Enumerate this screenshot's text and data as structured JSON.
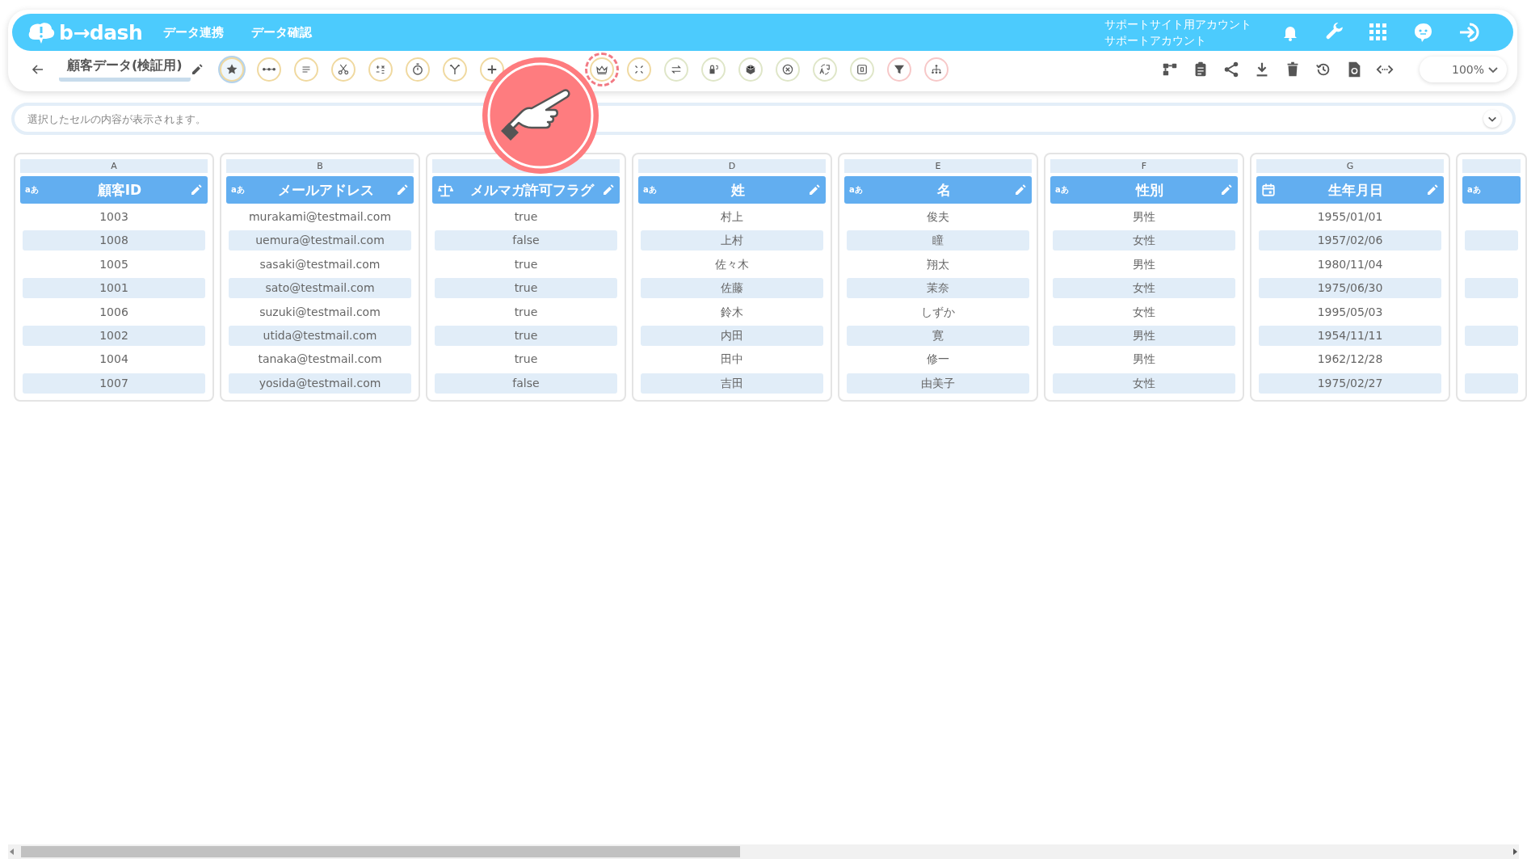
{
  "header": {
    "logo": "b→dash",
    "nav": [
      {
        "label": "データ連携"
      },
      {
        "label": "データ確認"
      }
    ],
    "account": {
      "line_1": "サポートサイト用アカウント",
      "line_2": "サポートアカウント"
    }
  },
  "toolbar": {
    "title": "顧客データ(検証用)",
    "tools": [
      {
        "color": "#f0d9a0",
        "selected": true,
        "highlighted": false
      },
      {
        "color": "#f0d9a0",
        "selected": false,
        "highlighted": false
      },
      {
        "color": "#f0d9a0",
        "selected": false,
        "highlighted": false
      },
      {
        "color": "#f0d9a0",
        "selected": false,
        "highlighted": false
      },
      {
        "color": "#f0d9a0",
        "selected": false,
        "highlighted": false
      },
      {
        "color": "#f0d9a0",
        "selected": false,
        "highlighted": false
      },
      {
        "color": "#f0d9a0",
        "selected": false,
        "highlighted": false
      },
      {
        "color": "#f0d9a0",
        "selected": false,
        "highlighted": false
      },
      {
        "color": "#f0d9a0",
        "selected": false,
        "highlighted": true
      },
      {
        "color": "#f0d9a0",
        "selected": false,
        "highlighted": false
      },
      {
        "color": "#dfe6c8",
        "selected": false,
        "highlighted": false
      },
      {
        "color": "#dfe6c8",
        "selected": false,
        "highlighted": false
      },
      {
        "color": "#dfe6c8",
        "selected": false,
        "highlighted": false
      },
      {
        "color": "#dfe6c8",
        "selected": false,
        "highlighted": false
      },
      {
        "color": "#dfe6c8",
        "selected": false,
        "highlighted": false
      },
      {
        "color": "#dfe6c8",
        "selected": false,
        "highlighted": false
      },
      {
        "color": "#f7c8c8",
        "selected": false,
        "highlighted": false
      },
      {
        "color": "#f7c8c8",
        "selected": false,
        "highlighted": false
      }
    ],
    "zoom": "100%"
  },
  "cell_viewer": {
    "placeholder": "選択したセルの内容が表示されます。"
  },
  "columns": [
    {
      "letter": "A",
      "kind": "text",
      "type_mark": "aあ",
      "title": "顧客ID",
      "cells": [
        "1003",
        "1008",
        "1005",
        "1001",
        "1006",
        "1002",
        "1004",
        "1007"
      ]
    },
    {
      "letter": "B",
      "kind": "text",
      "type_mark": "aあ",
      "title": "メールアドレス",
      "cells": [
        "murakami@testmail.com",
        "uemura@testmail.com",
        "sasaki@testmail.com",
        "sato@testmail.com",
        "suzuki@testmail.com",
        "utida@testmail.com",
        "tanaka@testmail.com",
        "yosida@testmail.com"
      ]
    },
    {
      "kind": "flag",
      "title": "メルマガ許可フラグ",
      "cells": [
        "true",
        "false",
        "true",
        "true",
        "true",
        "true",
        "true",
        "false"
      ]
    },
    {
      "letter": "D",
      "kind": "text",
      "type_mark": "aあ",
      "title": "姓",
      "cells": [
        "村上",
        "上村",
        "佐々木",
        "佐藤",
        "鈴木",
        "内田",
        "田中",
        "吉田"
      ]
    },
    {
      "letter": "E",
      "kind": "text",
      "type_mark": "aあ",
      "title": "名",
      "cells": [
        "俊夫",
        "瞳",
        "翔太",
        "茉奈",
        "しずか",
        "寛",
        "修一",
        "由美子"
      ]
    },
    {
      "letter": "F",
      "kind": "text",
      "type_mark": "aあ",
      "title": "性別",
      "cells": [
        "男性",
        "女性",
        "男性",
        "女性",
        "女性",
        "男性",
        "男性",
        "女性"
      ]
    },
    {
      "letter": "G",
      "kind": "date",
      "title": "生年月日",
      "cells": [
        "1955/01/01",
        "1957/02/06",
        "1980/11/04",
        "1975/06/30",
        "1995/05/03",
        "1954/11/11",
        "1962/12/28",
        "1975/02/27"
      ]
    },
    {
      "kind": "text",
      "type_mark": "aあ"
    }
  ]
}
